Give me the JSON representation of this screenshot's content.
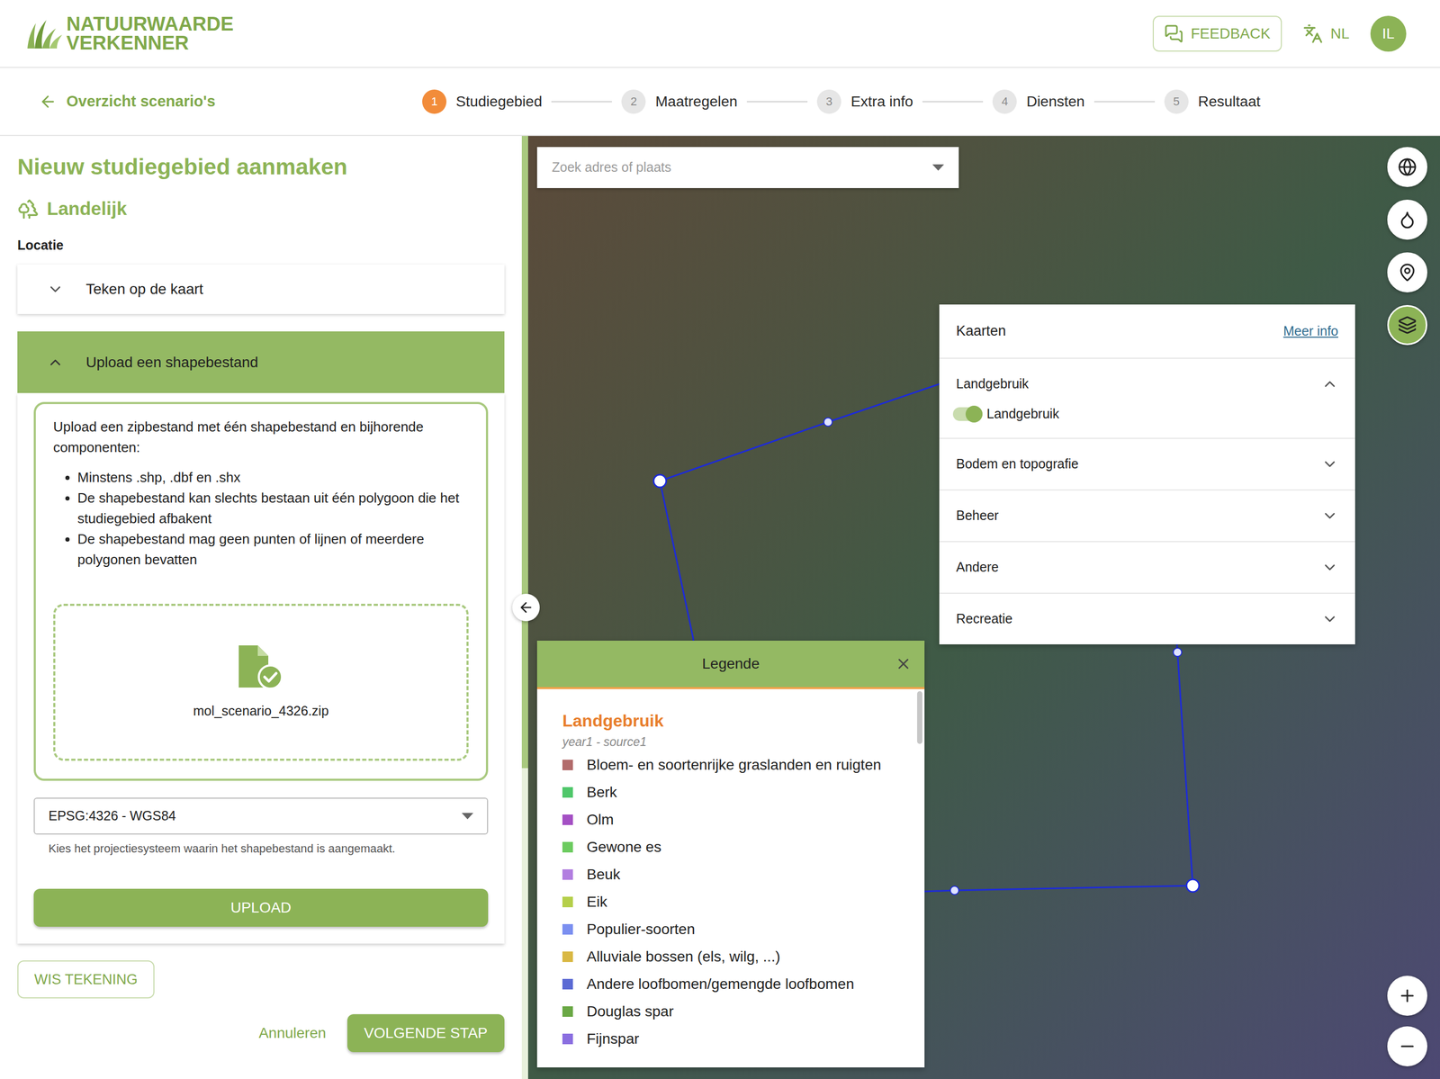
{
  "header": {
    "logo": [
      "NATUURWAARDE",
      "VERKENNER"
    ],
    "feedback": "FEEDBACK",
    "language": "NL",
    "avatar": "IL"
  },
  "nav": {
    "back": "Overzicht scenario's",
    "steps": [
      {
        "number": "1",
        "label": "Studiegebied",
        "selected": true
      },
      {
        "number": "2",
        "label": "Maatregelen",
        "selected": false
      },
      {
        "number": "3",
        "label": "Extra info",
        "selected": false
      },
      {
        "number": "4",
        "label": "Diensten",
        "selected": false
      },
      {
        "number": "5",
        "label": "Resultaat",
        "selected": false
      }
    ]
  },
  "panel": {
    "title": "Nieuw studiegebied aanmaken",
    "category": "Landelijk",
    "location_label": "Locatie",
    "sections": [
      {
        "label": "Teken op de kaart",
        "expanded": false
      },
      {
        "label": "Upload een shapebestand",
        "expanded": true
      }
    ],
    "upload": {
      "intro": "Upload een zipbestand met één shapebestand en bijhorende componenten:",
      "rules": [
        "Minstens .shp, .dbf en .shx",
        "De shapebestand kan slechts bestaan uit één polygoon die het studiegebied afbakent",
        "De shapebestand mag geen punten of lijnen of meerdere polygonen bevatten"
      ],
      "file": "mol_scenario_4326.zip",
      "projection": "EPSG:4326 - WGS84",
      "projection_help": "Kies het projectiesysteem waarin het shapebestand is aangemaakt.",
      "button": "UPLOAD"
    },
    "clear": "WIS TEKENING",
    "cancel": "Annuleren",
    "next": "VOLGENDE STAP"
  },
  "map": {
    "search_placeholder": "Zoek adres of plaats",
    "controls": [
      {
        "selected": false
      },
      {
        "selected": false
      },
      {
        "selected": false
      },
      {
        "selected": true
      }
    ],
    "layers_panel": {
      "title": "Kaarten",
      "more": "Meer info",
      "groups": [
        {
          "label": "Landgebruik",
          "expanded": true,
          "layers": [
            {
              "label": "Landgebruik",
              "on": true
            }
          ]
        },
        {
          "label": "Bodem en topografie",
          "expanded": false,
          "layers": []
        },
        {
          "label": "Beheer",
          "expanded": false,
          "layers": []
        },
        {
          "label": "Andere",
          "expanded": false,
          "layers": []
        },
        {
          "label": "Recreatie",
          "expanded": false,
          "layers": []
        }
      ]
    },
    "legend": {
      "title": "Legende",
      "group": "Landgebruik",
      "subtitle": "year1 - source1",
      "items": [
        {
          "label": "Bloem- en soortenrijke graslanden en ruigten",
          "color": "#b26b6b"
        },
        {
          "label": "Berk",
          "color": "#4fc76a"
        },
        {
          "label": "Olm",
          "color": "#a450c4"
        },
        {
          "label": "Gewone es",
          "color": "#6ccb5f"
        },
        {
          "label": "Beuk",
          "color": "#b27ee0"
        },
        {
          "label": "Eik",
          "color": "#b5cf4a"
        },
        {
          "label": "Populier-soorten",
          "color": "#7b8ff0"
        },
        {
          "label": "Alluviale bossen (els, wilg, ...)",
          "color": "#d9b843"
        },
        {
          "label": "Andere loofbomen/gemengde loofbomen",
          "color": "#5b6ad4"
        },
        {
          "label": "Douglas spar",
          "color": "#6aa845"
        },
        {
          "label": "Fijnspar",
          "color": "#8a6ee0"
        }
      ]
    }
  }
}
